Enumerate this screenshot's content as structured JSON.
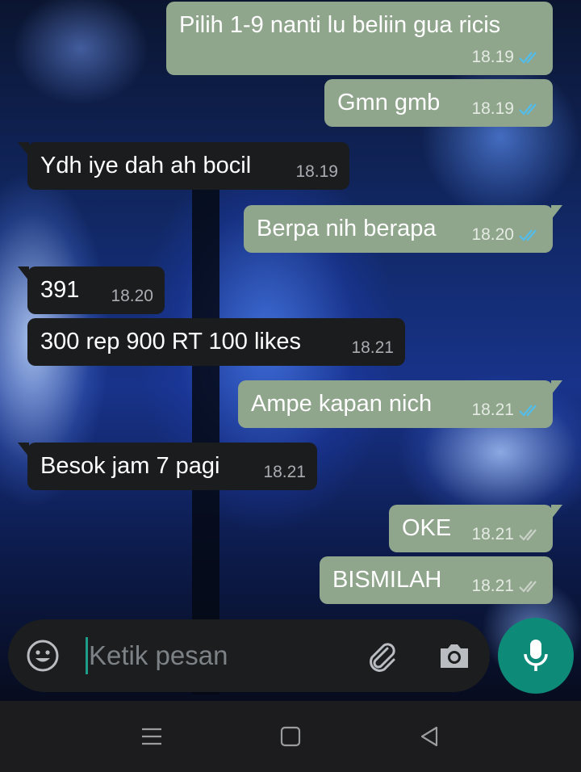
{
  "chat": {
    "messages": [
      {
        "direction": "out",
        "text": "Pilih 1-9 nanti lu beliin gua ricis",
        "time": "18.19",
        "status": "read"
      },
      {
        "direction": "out",
        "text": "Gmn gmb",
        "time": "18.19",
        "status": "read"
      },
      {
        "direction": "in",
        "text": "Ydh iye dah ah bocil",
        "time": "18.19"
      },
      {
        "direction": "out",
        "text": "Berpa nih berapa",
        "time": "18.20",
        "status": "read"
      },
      {
        "direction": "in",
        "text": "391",
        "time": "18.20"
      },
      {
        "direction": "in",
        "text": "300 rep 900 RT 100 likes",
        "time": "18.21"
      },
      {
        "direction": "out",
        "text": "Ampe kapan nich",
        "time": "18.21",
        "status": "read"
      },
      {
        "direction": "in",
        "text": "Besok jam 7 pagi",
        "time": "18.21"
      },
      {
        "direction": "out",
        "text": "OKE",
        "time": "18.21",
        "status": "delivered"
      },
      {
        "direction": "out",
        "text": "BISMILAH",
        "time": "18.21",
        "status": "delivered"
      }
    ]
  },
  "composer": {
    "placeholder": "Ketik pesan",
    "value": "",
    "icons": [
      "emoji-icon",
      "attach-icon",
      "camera-icon",
      "mic-icon"
    ]
  },
  "navbar": {
    "icons": [
      "menu-icon",
      "home-icon",
      "back-icon"
    ]
  },
  "colors": {
    "outgoing_bubble": "#8fa58c",
    "incoming_bubble": "#1b1c1e",
    "read_ticks": "#53bdeb",
    "delivered_ticks": "#c9d2c7",
    "mic_button": "#0e8a78"
  }
}
